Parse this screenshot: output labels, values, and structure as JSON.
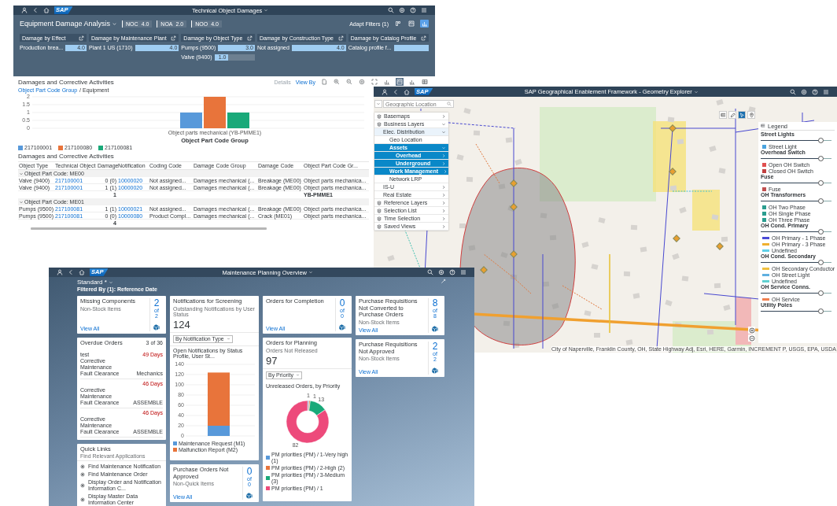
{
  "damage_app": {
    "shell": {
      "logo": "SAP",
      "title": "Technical Object Damages"
    },
    "page_title": "Equipment Damage Analysis",
    "kpis": [
      {
        "label": "NOC",
        "value": "4.0"
      },
      {
        "label": "NOA",
        "value": "2.0"
      },
      {
        "label": "NOO",
        "value": "4.0"
      }
    ],
    "adapt_filters": "Adapt Filters (1)",
    "header_view_buttons": [
      {
        "kind": "compact",
        "selected": false
      },
      {
        "kind": "chart-table",
        "selected": false
      },
      {
        "kind": "column-chart",
        "selected": true
      }
    ],
    "filter_cards": [
      {
        "title": "Damage by Effect",
        "bars": [
          {
            "label": "Production brea...",
            "value": "4.0",
            "level": 1
          }
        ]
      },
      {
        "title": "Damage by Maintenance Plant",
        "bars": [
          {
            "label": "Plant 1 US (1710)",
            "value": "4.0",
            "level": 1
          }
        ]
      },
      {
        "title": "Damage by Object Type",
        "bars": [
          {
            "label": "Pumps (9500)",
            "value": "3.0",
            "level": 1
          },
          {
            "label": "Valve (9400)",
            "value": "1.0",
            "level": 0.33
          }
        ]
      },
      {
        "title": "Damage by Construction Type",
        "bars": [
          {
            "label": "Not assigned",
            "value": "4.0",
            "level": 1
          }
        ]
      },
      {
        "title": "Damage by Catalog Profile",
        "bars": [
          {
            "label": "Catalog profile f...",
            "level": 1
          }
        ]
      }
    ],
    "section_title": "Damages and Corrective Activities",
    "toolbar": [
      {
        "label": "Details",
        "disabled": true
      },
      {
        "label": "View By",
        "disabled": false
      }
    ],
    "view_buttons": [
      {
        "kind": "bar-chart",
        "selected": false
      },
      {
        "kind": "chart-table",
        "selected": true
      },
      {
        "kind": "column-chart",
        "selected": false
      },
      {
        "kind": "table",
        "selected": false
      }
    ],
    "breadcrumb_link": "Object Part Code Group",
    "breadcrumb_current": "/ Equipment",
    "chart_data": {
      "type": "bar",
      "xlabel": "Object Part Code Group",
      "categories": [
        "Object parts mechanical (YB-PMME1)"
      ],
      "ylim": [
        0,
        2
      ],
      "yticks": [
        0,
        0.5,
        1,
        1.5,
        2
      ],
      "grid": true,
      "series": [
        {
          "name": "217100001",
          "color": "#5899da",
          "values": [
            1
          ]
        },
        {
          "name": "217100080",
          "color": "#e8743b",
          "values": [
            2
          ]
        },
        {
          "name": "217100081",
          "color": "#19a979",
          "values": [
            1
          ]
        }
      ]
    },
    "table_title": "Damages and Corrective Activities",
    "table": {
      "columns": [
        {
          "label": "Object Type",
          "kind": "text"
        },
        {
          "label": "Technical Object",
          "kind": "link"
        },
        {
          "label": "Damage",
          "kind": "number"
        },
        {
          "label": "Notification",
          "kind": "link"
        },
        {
          "label": "Coding Code",
          "kind": "text"
        },
        {
          "label": "Damage Code Group",
          "kind": "text"
        },
        {
          "label": "Damage Code",
          "kind": "text"
        },
        {
          "label": "Object Part Code Gr...",
          "kind": "text"
        }
      ],
      "groups": [
        {
          "title": "Object Part Code: ME00",
          "expanded": true,
          "rows": [
            [
              "Valve (9400)",
              "217100001",
              "0 (0)",
              "10000020",
              "Not assigned...",
              "Damages mechanical (...",
              "Breakage (ME00)",
              "Object parts mechanica..."
            ],
            [
              "Valve (9400)",
              "217100001",
              "1 (1)",
              "10000020",
              "Not assigned...",
              "Damages mechanical (...",
              "Breakage (ME00)",
              "Object parts mechanica..."
            ]
          ],
          "total_damage": "1",
          "total_part": "YB-PMME1"
        },
        {
          "title": "Object Part Code: ME01",
          "expanded": true,
          "rows": [
            [
              "Pumps (9500)",
              "217100081",
              "1 (1)",
              "10000021",
              "Not assigned...",
              "Damages mechanical (...",
              "Breakage (ME00)",
              "Object parts mechanica..."
            ],
            [
              "Pumps (9500)",
              "217100081",
              "0 (0)",
              "10000080",
              "Product Compl...",
              "Damages mechanical (...",
              "Crack (ME01)",
              "Object parts mechanica..."
            ]
          ]
        }
      ],
      "grand_total_damage": "4"
    }
  },
  "map_app": {
    "shell": {
      "logo": "SAP",
      "title": "SAP Geographical Enablement Framework - Geometry Explorer"
    },
    "search_placeholder": "Geographic Location",
    "layers": [
      {
        "label": "Basemaps",
        "expanded": false,
        "selected": false
      },
      {
        "label": "Business Layers",
        "expanded": true,
        "selected": false,
        "children": [
          {
            "label": "Elec. Distribution",
            "expanded": true,
            "selected": false,
            "children": [
              {
                "label": "Geo Location",
                "selected": false
              },
              {
                "label": "Assets",
                "expanded": true,
                "selected": true,
                "children": [
                  {
                    "label": "Overhead",
                    "expanded": false,
                    "selected": true
                  },
                  {
                    "label": "Underground",
                    "expanded": false,
                    "selected": true
                  }
                ]
              },
              {
                "label": "Work Management",
                "expanded": false,
                "selected": true
              },
              {
                "label": "Network LRP",
                "selected": false
              }
            ]
          },
          {
            "label": "IS-U",
            "expanded": false,
            "selected": false
          },
          {
            "label": "Real Estate",
            "expanded": false,
            "selected": false
          }
        ]
      },
      {
        "label": "Reference Layers",
        "expanded": false,
        "selected": false
      },
      {
        "label": "Selection List",
        "expanded": false,
        "selected": false
      },
      {
        "label": "Time Selection",
        "expanded": false,
        "selected": false
      },
      {
        "label": "Saved Views",
        "expanded": false,
        "selected": false
      }
    ],
    "map_tools": [
      {
        "kind": "list",
        "selected": false
      },
      {
        "kind": "pencil",
        "selected": false
      },
      {
        "kind": "select",
        "selected": true
      },
      {
        "kind": "pin",
        "selected": false
      }
    ],
    "legend": {
      "title": "Legend",
      "groups": [
        {
          "title": "Street Lights",
          "level": 0.85,
          "items": [
            {
              "label": "Street Light",
              "kind": "point",
              "color": "#4aa3df"
            }
          ]
        },
        {
          "title": "Overhead Switch",
          "level": 0.85,
          "items": [
            {
              "label": "Open OH Switch",
              "kind": "point",
              "color": "#e05050"
            },
            {
              "label": "Closed OH Switch",
              "kind": "point",
              "color": "#c04040"
            }
          ]
        },
        {
          "title": "Fuse",
          "level": 0.85,
          "items": [
            {
              "label": "Fuse",
              "kind": "point",
              "color": "#c05050"
            }
          ]
        },
        {
          "title": "OH Transformers",
          "level": 0.85,
          "items": [
            {
              "label": "OH Two Phase",
              "kind": "point",
              "color": "#2a9d8f"
            },
            {
              "label": "OH Single Phase",
              "kind": "point",
              "color": "#2a9d8f"
            },
            {
              "label": "OH Three Phase",
              "kind": "point",
              "color": "#2a9d8f"
            }
          ]
        },
        {
          "title": "OH Cond. Primary",
          "level": 0.85,
          "items": [
            {
              "label": "OH Primary - 1 Phase",
              "kind": "line",
              "color": "#4b4bd6"
            },
            {
              "label": "OH Primary - 3 Phase",
              "kind": "line",
              "color": "#f0b030"
            },
            {
              "label": "Undefined",
              "kind": "line",
              "color": "#60d0e8"
            }
          ]
        },
        {
          "title": "OH Cond. Secondary",
          "level": 0.85,
          "items": [
            {
              "label": "OH Secondary Conductor",
              "kind": "line",
              "color": "#f0c040"
            },
            {
              "label": "OH Street Light",
              "kind": "line",
              "color": "#60b0e0"
            },
            {
              "label": "Undefined",
              "kind": "line",
              "color": "#60d0d0"
            }
          ]
        },
        {
          "title": "OH Service Conns.",
          "level": 0.85,
          "items": [
            {
              "label": "OH Service",
              "kind": "line",
              "color": "#f08050"
            }
          ]
        },
        {
          "title": "Utility Poles",
          "level": 0.85
        }
      ]
    },
    "attribution": "City of Naperville, Franklin County, OH, State Highway Adj, Esri, HERE, Garmin, INCREMENT P, USGS, EPA, USDA"
  },
  "overview_app": {
    "shell": {
      "logo": "SAP",
      "title": "Maintenance Planning Overview"
    },
    "variant": "Standard *",
    "filter_info": "Filtered By (1): Reference Date",
    "columns": [
      [
        {
          "kind": "kpi",
          "title": "Missing Components",
          "subtitle": "Non-Stock Items",
          "value": "2",
          "of": "of",
          "total": "2",
          "link": "View All"
        },
        {
          "kind": "list",
          "title": "Overdue Orders",
          "count": "3 of 36",
          "items": [
            {
              "title": "test",
              "days": "49 Days",
              "type": "Corrective Maintenance",
              "activity": "Fault Clearance",
              "group": "Mechanics"
            },
            {
              "days": "46 Days",
              "type": "Corrective Maintenance",
              "activity": "Fault Clearance",
              "group": "ASSEMBLE"
            },
            {
              "days": "46 Days",
              "type": "Corrective Maintenance",
              "activity": "Fault Clearance",
              "group": "ASSEMBLE"
            }
          ]
        },
        {
          "kind": "links",
          "title": "Quick Links",
          "subtitle": "Find Relevant Applications",
          "links": [
            "Find Maintenance Notification",
            "Find Maintenance Order",
            "Display Order and Notification Information C...",
            "Display Master Data Information Center"
          ]
        }
      ],
      [
        {
          "kind": "bar",
          "title": "Notifications for Screening",
          "subtitle": "Outstanding Notifications by User Status",
          "value": "124",
          "select": "By Notification Type",
          "chart_data": {
            "type": "bar",
            "stacked": true,
            "title": "Open Notifications by Status Profile, User St...",
            "ylim": [
              0,
              140
            ],
            "yticks": [
              0,
              20,
              40,
              60,
              80,
              100,
              120,
              140
            ],
            "grid": true,
            "series": [
              {
                "name": "Maintenance Request (M1)",
                "color": "#5899da",
                "values": [
                  20
                ]
              },
              {
                "name": "Malfunction Report (M2)",
                "color": "#e8743b",
                "values": [
                  104
                ]
              }
            ]
          }
        },
        {
          "kind": "kpi",
          "title": "Purchase Orders Not Approved",
          "subtitle": "Non-Quick Items",
          "value": "0",
          "of": "of",
          "total": "0",
          "link": "View All"
        }
      ],
      [
        {
          "kind": "kpi",
          "title": "Orders for Completion",
          "value": "0",
          "of": "of",
          "total": "0",
          "link": "View All"
        },
        {
          "kind": "donut",
          "title": "Orders for Planning",
          "subtitle": "Orders Not Released",
          "value": "97",
          "select": "By Priority",
          "chart_data": {
            "type": "donut",
            "title": "Unreleased Orders, by Priority",
            "data_labels": true,
            "categories": [
              "PM priorities (PM) / 1-Very high (1)",
              "PM priorities (PM) / 2-High (2)",
              "PM priorities (PM) / 3-Medium (3)",
              "PM priorities (PM) / 1"
            ],
            "values": [
              1,
              1,
              13,
              82
            ],
            "colors": [
              "#5899da",
              "#e8743b",
              "#19a979",
              "#ed4a7b"
            ]
          }
        }
      ],
      [
        {
          "kind": "kpi",
          "title": "Purchase Requisitions Not Converted to Purchase Orders",
          "subtitle": "Non-Stock Items",
          "value": "8",
          "of": "of",
          "total": "8",
          "link": "View All"
        },
        {
          "kind": "kpi",
          "title": "Purchase Requisitions Not Approved",
          "subtitle": "Non-Stock Items",
          "value": "2",
          "of": "of",
          "total": "2",
          "link": "View All"
        }
      ]
    ]
  }
}
